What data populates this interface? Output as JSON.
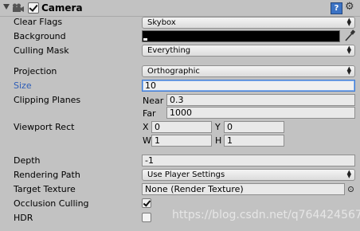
{
  "component": {
    "title": "Camera"
  },
  "labels": {
    "clear_flags": "Clear Flags",
    "background": "Background",
    "culling_mask": "Culling Mask",
    "projection": "Projection",
    "size": "Size",
    "clipping_planes": "Clipping Planes",
    "viewport_rect": "Viewport Rect",
    "depth": "Depth",
    "rendering_path": "Rendering Path",
    "target_texture": "Target Texture",
    "occlusion_culling": "Occlusion Culling",
    "hdr": "HDR"
  },
  "values": {
    "clear_flags": "Skybox",
    "background_color": "#000000",
    "culling_mask": "Everything",
    "projection": "Orthographic",
    "size": "10",
    "near_label": "Near",
    "near": "0.3",
    "far_label": "Far",
    "far": "1000",
    "x_label": "X",
    "x": "0",
    "y_label": "Y",
    "y": "0",
    "w_label": "W",
    "w": "1",
    "h_label": "H",
    "h": "1",
    "depth": "-1",
    "rendering_path": "Use Player Settings",
    "target_texture": "None (Render Texture)",
    "occlusion_culling": true,
    "hdr": false
  },
  "icons": {
    "foldout": "triangle-down-icon",
    "component": "camera-icon",
    "help": "help-book-icon",
    "settings": "gear-icon",
    "eyedropper": "eyedropper-icon",
    "object_picker": "object-picker-icon"
  },
  "colors": {
    "selection": "#3d7bd6",
    "active_label": "#2d5db7"
  },
  "watermark": "https://blog.csdn.net/q764424567"
}
